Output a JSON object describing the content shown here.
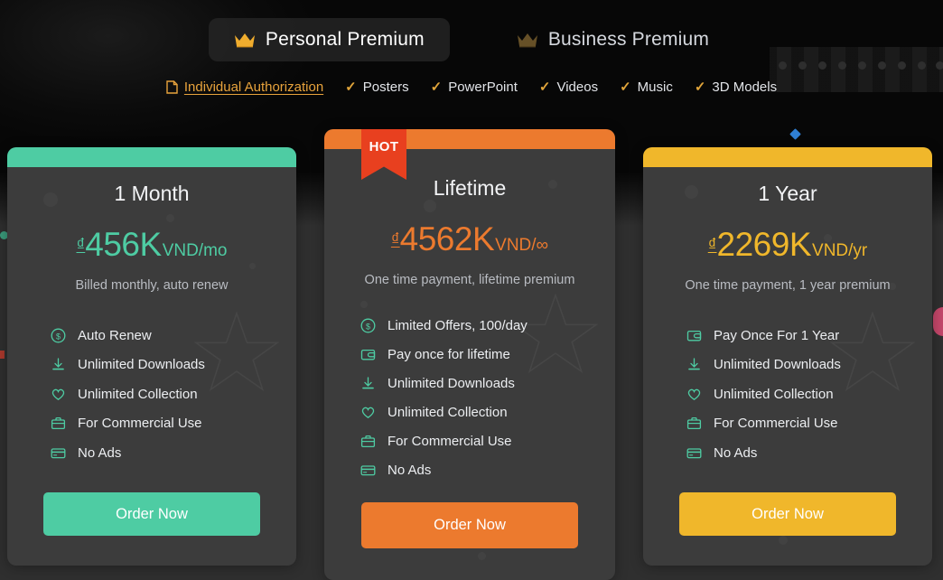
{
  "tabs": [
    {
      "label": "Personal Premium",
      "icon": "crown-icon",
      "active": true
    },
    {
      "label": "Business Premium",
      "icon": "crown-icon",
      "active": false
    }
  ],
  "subnav": [
    {
      "label": "Individual Authorization",
      "icon": "document-icon",
      "type": "link"
    },
    {
      "label": "Posters",
      "icon": "check-icon",
      "type": "check"
    },
    {
      "label": "PowerPoint",
      "icon": "check-icon",
      "type": "check"
    },
    {
      "label": "Videos",
      "icon": "check-icon",
      "type": "check"
    },
    {
      "label": "Music",
      "icon": "check-icon",
      "type": "check"
    },
    {
      "label": "3D Models",
      "icon": "check-icon",
      "type": "check"
    }
  ],
  "colors": {
    "teal": "#4ecca3",
    "orange": "#ec7a2e",
    "yellow": "#f0b72b",
    "ribbon_red": "#e8401f",
    "card_bg": "#3c3c3c",
    "page_bg": "#2f2f2f",
    "accent_amber": "#e8a33c"
  },
  "cards": [
    {
      "title": "1 Month",
      "currency": "₫",
      "amount": "456K",
      "period": "VND/mo",
      "subtitle": "Billed monthly, auto renew",
      "button_label": "Order Now",
      "accent": "#4ecca3",
      "badge": null,
      "features": [
        {
          "label": "Auto Renew",
          "icon": "dollar-circle-icon"
        },
        {
          "label": "Unlimited Downloads",
          "icon": "download-icon"
        },
        {
          "label": "Unlimited Collection",
          "icon": "heart-icon"
        },
        {
          "label": "For Commercial Use",
          "icon": "briefcase-icon"
        },
        {
          "label": "No Ads",
          "icon": "credit-card-icon"
        }
      ]
    },
    {
      "title": "Lifetime",
      "currency": "₫",
      "amount": "4562K",
      "period": "VND/∞",
      "subtitle": "One time payment, lifetime premium",
      "button_label": "Order Now",
      "accent": "#ec7a2e",
      "badge": "HOT",
      "features": [
        {
          "label": "Limited Offers, 100/day",
          "icon": "dollar-circle-icon"
        },
        {
          "label": "Pay once for lifetime",
          "icon": "wallet-icon"
        },
        {
          "label": "Unlimited Downloads",
          "icon": "download-icon"
        },
        {
          "label": "Unlimited Collection",
          "icon": "heart-icon"
        },
        {
          "label": "For Commercial Use",
          "icon": "briefcase-icon"
        },
        {
          "label": "No Ads",
          "icon": "credit-card-icon"
        }
      ]
    },
    {
      "title": "1 Year",
      "currency": "₫",
      "amount": "2269K",
      "period": "VND/yr",
      "subtitle": "One time payment, 1 year premium",
      "button_label": "Order Now",
      "accent": "#f0b72b",
      "badge": null,
      "features": [
        {
          "label": "Pay Once For 1 Year",
          "icon": "wallet-icon"
        },
        {
          "label": "Unlimited Downloads",
          "icon": "download-icon"
        },
        {
          "label": "Unlimited Collection",
          "icon": "heart-icon"
        },
        {
          "label": "For Commercial Use",
          "icon": "briefcase-icon"
        },
        {
          "label": "No Ads",
          "icon": "credit-card-icon"
        }
      ]
    }
  ]
}
